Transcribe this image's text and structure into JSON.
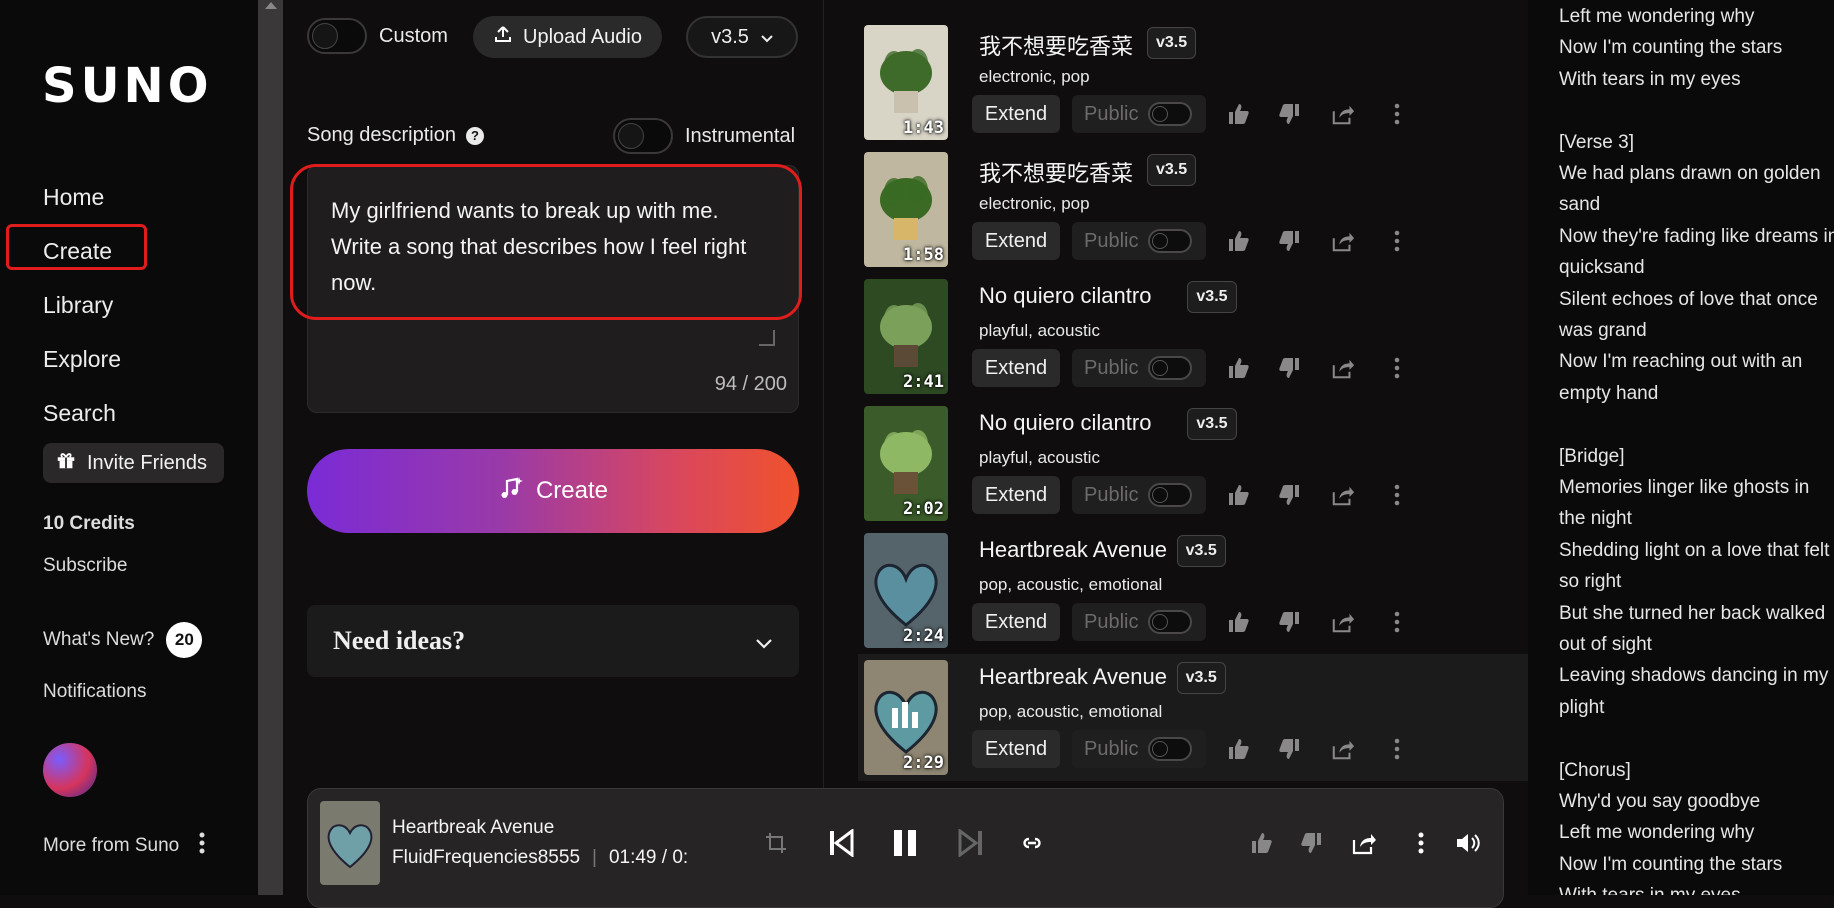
{
  "sidebar": {
    "logo": "SUNO",
    "nav": [
      "Home",
      "Create",
      "Library",
      "Explore",
      "Search"
    ],
    "invite_label": "Invite Friends",
    "credits": "10 Credits",
    "subscribe": "Subscribe",
    "whats_new": "What's New?",
    "whats_new_count": "20",
    "notifications": "Notifications",
    "more_from": "More from Suno"
  },
  "create_panel": {
    "custom_label": "Custom",
    "upload_label": "Upload Audio",
    "version": "v3.5",
    "description_label": "Song description",
    "instrumental_label": "Instrumental",
    "description_text": "My girlfriend wants to break up with me. Write a song that describes how I feel right now.",
    "counter": "94 / 200",
    "create_label": "Create",
    "ideas_label": "Need ideas?"
  },
  "songs": [
    {
      "title": "我不想要吃香菜",
      "version": "v3.5",
      "tags": "electronic, pop",
      "duration": "1:43",
      "extend": "Extend",
      "public": "Public"
    },
    {
      "title": "我不想要吃香菜",
      "version": "v3.5",
      "tags": "electronic, pop",
      "duration": "1:58",
      "extend": "Extend",
      "public": "Public"
    },
    {
      "title": "No quiero cilantro",
      "version": "v3.5",
      "tags": "playful, acoustic",
      "duration": "2:41",
      "extend": "Extend",
      "public": "Public"
    },
    {
      "title": "No quiero cilantro",
      "version": "v3.5",
      "tags": "playful, acoustic",
      "duration": "2:02",
      "extend": "Extend",
      "public": "Public"
    },
    {
      "title": "Heartbreak Avenue",
      "version": "v3.5",
      "tags": "pop, acoustic, emotional",
      "duration": "2:24",
      "extend": "Extend",
      "public": "Public"
    },
    {
      "title": "Heartbreak Avenue",
      "version": "v3.5",
      "tags": "pop, acoustic, emotional",
      "duration": "2:29",
      "extend": "Extend",
      "public": "Public"
    }
  ],
  "lyrics": [
    "Left me wondering why",
    "Now I'm counting the stars",
    "With tears in my eyes",
    "",
    "[Verse 3]",
    "We had plans drawn on golden",
    "sand",
    "Now they're fading like dreams in",
    "quicksand",
    "Silent echoes of love that once",
    "was grand",
    "Now I'm reaching out with an",
    "empty hand",
    "",
    "[Bridge]",
    "Memories linger like ghosts in",
    "the night",
    "Shedding light on a love that felt",
    "so right",
    "But she turned her back walked",
    "out of sight",
    "Leaving shadows dancing in my",
    "plight",
    "",
    "[Chorus]",
    "Why'd you say goodbye",
    "Left me wondering why",
    "Now I'm counting the stars",
    "With tears in my eyes"
  ],
  "player": {
    "title": "Heartbreak Avenue",
    "artist": "FluidFrequencies8555",
    "time": "01:49 / 0:"
  },
  "colors": {
    "highlight_red": "#e11c1c",
    "create_gradient_start": "#7a2bd6",
    "create_gradient_end": "#f0522c"
  }
}
